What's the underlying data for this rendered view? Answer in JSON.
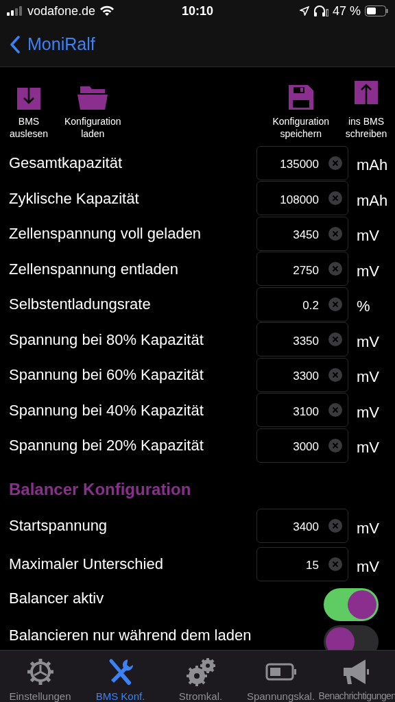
{
  "status_bar": {
    "carrier": "vodafone.de",
    "time": "10:10",
    "battery": "47 %"
  },
  "nav": {
    "back": "MoniRalf"
  },
  "toolbar": [
    {
      "kind": "download",
      "label": "BMS\nauslesen"
    },
    {
      "kind": "folder",
      "label": "Konfiguration\nladen"
    },
    {
      "kind": "save",
      "label": "Konfiguration\nspeichern"
    },
    {
      "kind": "upload",
      "label": "ins BMS\nschreiben"
    }
  ],
  "settings": [
    {
      "label": "Gesamtkapazität",
      "value": "135000",
      "unit": "mAh"
    },
    {
      "label": "Zyklische Kapazität",
      "value": "108000",
      "unit": "mAh"
    },
    {
      "label": "Zellenspannung voll geladen",
      "value": "3450",
      "unit": "mV"
    },
    {
      "label": "Zellenspannung entladen",
      "value": "2750",
      "unit": "mV"
    },
    {
      "label": "Selbstentladungsrate",
      "value": "0.2",
      "unit": "%"
    },
    {
      "label": "Spannung bei 80% Kapazität",
      "value": "3350",
      "unit": "mV"
    },
    {
      "label": "Spannung bei 60% Kapazität",
      "value": "3300",
      "unit": "mV"
    },
    {
      "label": "Spannung bei 40% Kapazität",
      "value": "3100",
      "unit": "mV"
    },
    {
      "label": "Spannung bei 20% Kapazität",
      "value": "3000",
      "unit": "mV"
    }
  ],
  "balancer": {
    "title": "Balancer Konfiguration",
    "fields": [
      {
        "label": "Startspannung",
        "value": "3400",
        "unit": "mV"
      },
      {
        "label": "Maximaler Unterschied",
        "value": "15",
        "unit": "mV"
      }
    ],
    "toggles": [
      {
        "label": "Balancer aktiv",
        "on": true
      },
      {
        "label": "Balancieren nur während dem laden",
        "on": false
      }
    ]
  },
  "tab_bar": [
    {
      "kind": "gear",
      "label": "Einstellungen",
      "selected": false
    },
    {
      "kind": "tools",
      "label": "BMS Konf.",
      "selected": true
    },
    {
      "kind": "gears",
      "label": "Stromkal.",
      "selected": false
    },
    {
      "kind": "battery",
      "label": "Spannungskal.",
      "selected": false
    },
    {
      "kind": "megaphone",
      "label": "Benachrichtigungen",
      "selected": false
    }
  ]
}
